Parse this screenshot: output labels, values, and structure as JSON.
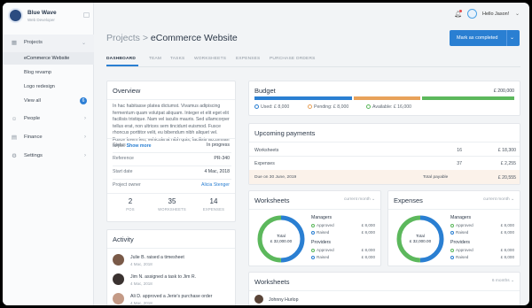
{
  "app": {
    "name": "Blue Wave",
    "subtitle": "Web Developer"
  },
  "sidebar": {
    "items": [
      {
        "label": "Projects"
      },
      {
        "label": "People"
      },
      {
        "label": "Finance"
      },
      {
        "label": "Settings"
      }
    ],
    "subitems": [
      {
        "label": "eCommerce Website"
      },
      {
        "label": "Blog revamp"
      },
      {
        "label": "Logo redesign"
      },
      {
        "label": "View all",
        "badge": "6"
      }
    ]
  },
  "topbar": {
    "greeting": "Hello Jason!"
  },
  "breadcrumb": {
    "parent": "Projects",
    "sep": ">",
    "current": "eCommerce Website"
  },
  "cta": {
    "label": "Mark as completed"
  },
  "tabs": [
    {
      "label": "DASHBOARD"
    },
    {
      "label": "TEAM"
    },
    {
      "label": "TASKS"
    },
    {
      "label": "WORKSHEETS"
    },
    {
      "label": "EXPENSES"
    },
    {
      "label": "PURCHASE ORDERS"
    }
  ],
  "overview": {
    "title": "Overview",
    "text": "In hac habitasse platea dictumst. Vivamus adipiscing fermentum quam volutpat aliquam. Integer et elit eget elit facilisis tristique. Nam vel iaculis mauris. Sed ullamcorper tellus erat, non ultrices sem tincidunt euismod. Fusce rhoncus porttitor velit, eu bibendum nibh aliquet vel. Fusce lorem leo, vehicula at nibh quis, facilisis accumsan turpis.",
    "show_more": "Show more",
    "details": [
      {
        "label": "Status",
        "value": "In progress"
      },
      {
        "label": "Reference",
        "value": "PR-340"
      },
      {
        "label": "Start date",
        "value": "4 Mac, 2018"
      },
      {
        "label": "Project owner",
        "value": "Alicia Stenger"
      }
    ],
    "stats": [
      {
        "n": "2",
        "label": "POS"
      },
      {
        "n": "35",
        "label": "WORKSHEETS"
      },
      {
        "n": "14",
        "label": "EXPENSES"
      }
    ]
  },
  "activity": {
    "title": "Activity",
    "items": [
      {
        "text": "Julie B. raised a timesheet",
        "date": "4 Mac, 2018"
      },
      {
        "text": "Jim N. assigned a task to Jim R.",
        "date": "4 Mac, 2018"
      },
      {
        "text": "Ali D. approved a Jerie's purchase order",
        "date": "4 Mac, 2018"
      }
    ]
  },
  "budget": {
    "title": "Budget",
    "total": "£ 200,000",
    "used_label": "Used: £ 8,000",
    "pending_label": "Pending: £ 8,000",
    "available_label": "Available: £ 16,000",
    "used_fraction": 0.38,
    "pending_fraction": 0.26,
    "available_fraction": 0.36,
    "colors": {
      "used": "#2a7fd2",
      "pending": "#e8a25a",
      "available": "#5cb85c"
    }
  },
  "upcoming": {
    "title": "Upcoming payments",
    "rows": [
      {
        "label": "Worksheets",
        "count": "16",
        "amount": "£ 18,300"
      },
      {
        "label": "Expenses",
        "count": "37",
        "amount": "£ 2,255"
      }
    ],
    "due": {
      "label": "Due on 30 June, 2019",
      "total_label": "Total payable",
      "amount": "£ 20,555"
    }
  },
  "worksheets_card": {
    "title": "Worksheets",
    "period": "current month",
    "total_label": "Total",
    "total_value": "£ 32,000.00",
    "managers": "Managers",
    "providers": "Providers",
    "m_approved": "Approved",
    "m_approved_v": "£ 8,000",
    "m_raised": "Raised",
    "m_raised_v": "£ 8,000",
    "p_approved": "Approved",
    "p_approved_v": "£ 8,000",
    "p_raised": "Raised",
    "p_raised_v": "£ 8,000",
    "segments": [
      0.5,
      0.5
    ],
    "colors": [
      "#2a7fd2",
      "#5cb85c"
    ]
  },
  "expenses_card": {
    "title": "Expenses",
    "period": "current month",
    "total_label": "Total",
    "total_value": "£ 32,000.00",
    "managers": "Managers",
    "providers": "Providers",
    "m_approved": "Approved",
    "m_approved_v": "£ 8,000",
    "m_raised": "Raised",
    "m_raised_v": "£ 8,000",
    "p_approved": "Approved",
    "p_approved_v": "£ 8,000",
    "p_raised": "Raised",
    "p_raised_v": "£ 8,000",
    "segments": [
      0.5,
      0.5
    ],
    "colors": [
      "#2a7fd2",
      "#5cb85c"
    ]
  },
  "worksheets_list": {
    "title": "Worksheets",
    "period": "6 months",
    "first_row": "Johnny Hurlop"
  }
}
